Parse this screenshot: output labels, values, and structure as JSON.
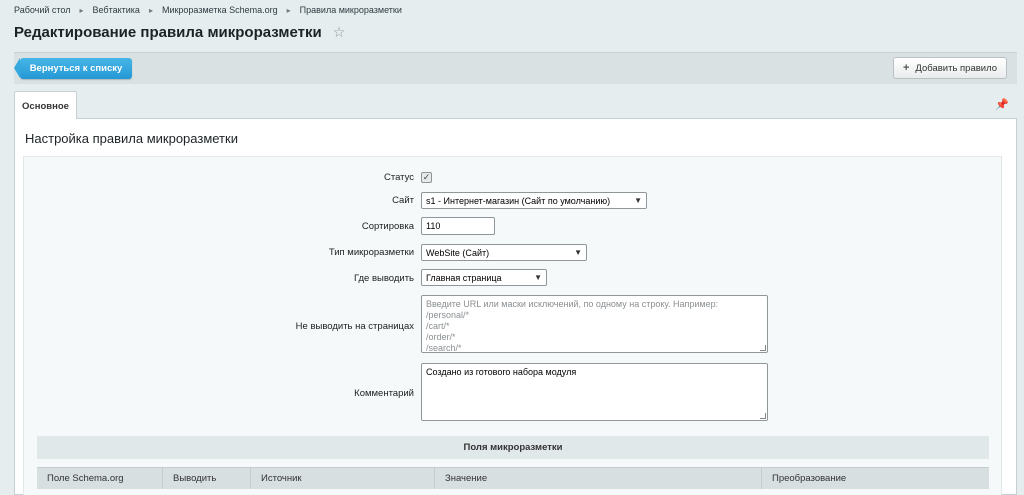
{
  "breadcrumbs": [
    "Рабочий стол",
    "Вебтактика",
    "Микроразметка Schema.org",
    "Правила микроразметки"
  ],
  "page_title": "Редактирование правила микроразметки",
  "toolbar": {
    "back_label": "Вернуться к списку",
    "add_label": "Добавить правило"
  },
  "tabs": [
    {
      "label": "Основное"
    }
  ],
  "section_title": "Настройка правила микроразметки",
  "form": {
    "status_label": "Статус",
    "site_label": "Сайт",
    "site_value": "s1 - Интернет-магазин (Сайт по умолчанию)",
    "sort_label": "Сортировка",
    "sort_value": "110",
    "type_label": "Тип микроразметки",
    "type_value": "WebSite (Сайт)",
    "where_label": "Где выводить",
    "where_value": "Главная страница",
    "exclude_label": "Не выводить на страницах",
    "exclude_placeholder": "Введите URL или маски исключений, по одному на строку. Например:\n/personal/*\n/cart/*\n/order/*\n/search/*",
    "comment_label": "Комментарий",
    "comment_value": "Создано из готового набора модуля"
  },
  "fields_section": {
    "title": "Поля микроразметки",
    "columns": [
      "Поле Schema.org",
      "Выводить",
      "Источник",
      "Значение",
      "Преобразование"
    ]
  },
  "colors": {
    "primary_button": "#2498d6",
    "background": "#e5edef"
  }
}
